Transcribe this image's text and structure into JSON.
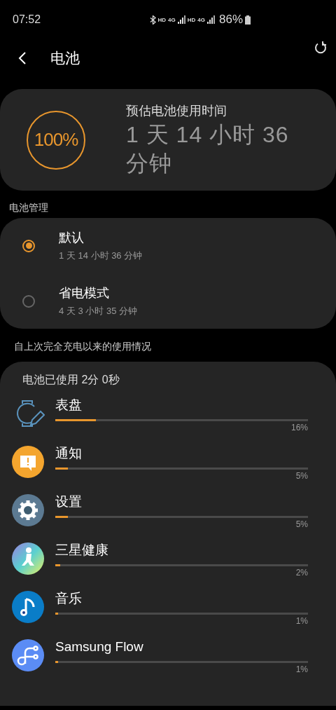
{
  "status_bar": {
    "time": "07:52",
    "indicators": [
      "HD",
      "4G",
      "HD",
      "4G"
    ],
    "battery": "86%"
  },
  "header": {
    "title": "电池"
  },
  "estimate": {
    "charge": "100%",
    "label": "预估电池使用时间",
    "time": "1 天 14 小时 36 分钟"
  },
  "battery_management": {
    "heading": "电池管理",
    "modes": [
      {
        "name": "默认",
        "time": "1 天 14 小时 36 分钟",
        "selected": true
      },
      {
        "name": "省电模式",
        "time": "4 天 3 小时 35 分钟",
        "selected": false
      }
    ]
  },
  "usage": {
    "heading": "自上次完全充电以来的使用情况",
    "total": "电池已使用 2分 0秒",
    "apps": [
      {
        "name": "表盘",
        "level": 0.16,
        "percent": "16%"
      },
      {
        "name": "通知",
        "level": 0.05,
        "percent": "5%"
      },
      {
        "name": "设置",
        "level": 0.05,
        "percent": "5%"
      },
      {
        "name": "三星健康",
        "level": 0.02,
        "percent": "2%"
      },
      {
        "name": "音乐",
        "level": 0.01,
        "percent": "1%"
      },
      {
        "name": "Samsung Flow",
        "level": 0.01,
        "percent": "1%"
      }
    ]
  }
}
